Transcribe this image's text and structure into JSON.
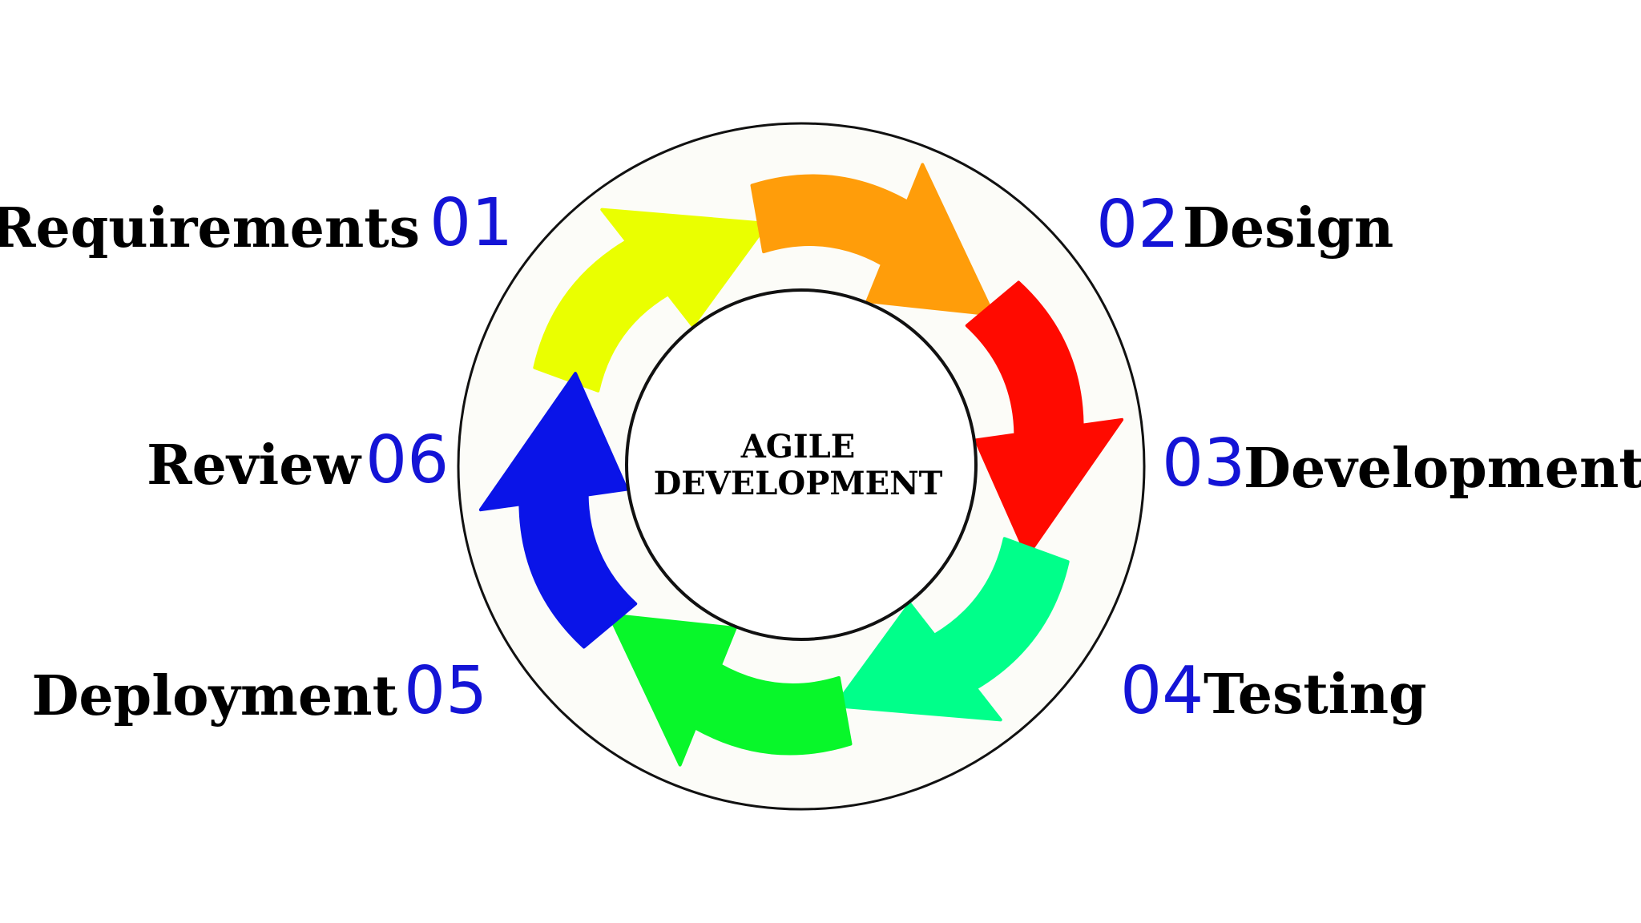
{
  "diagram": {
    "center": {
      "line1": "AGILE",
      "line2": "DEVELOPMENT"
    },
    "colors": {
      "ring_fill": "#fcfcf8",
      "ring_stroke": "#111111",
      "number": "#1414d6",
      "label": "#000000"
    },
    "stages": [
      {
        "number": "01",
        "label": "Requirements",
        "color": "#eaff00"
      },
      {
        "number": "02",
        "label": "Design",
        "color": "#ff9d0a"
      },
      {
        "number": "03",
        "label": "Development",
        "color": "#ff0a00"
      },
      {
        "number": "04",
        "label": "Testing",
        "color": "#00ff8a"
      },
      {
        "number": "05",
        "label": "Deployment",
        "color": "#08f72a"
      },
      {
        "number": "06",
        "label": "Review",
        "color": "#0a14e8"
      }
    ]
  }
}
